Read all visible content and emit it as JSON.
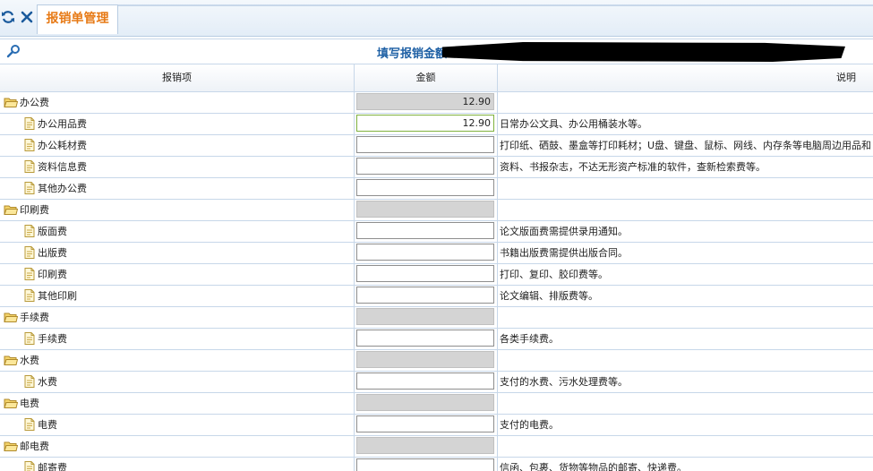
{
  "tab": {
    "title": "报销单管理"
  },
  "title_bar": {
    "title": "填写报销金额"
  },
  "grid": {
    "headers": {
      "item": "报销项",
      "amount": "金额",
      "description": "说明"
    },
    "rows": [
      {
        "name": "办公费",
        "amount": "12.90",
        "description": ""
      },
      {
        "name": "办公用品费",
        "amount": "12.90",
        "description": "日常办公文具、办公用桶装水等。"
      },
      {
        "name": "办公耗材费",
        "amount": "",
        "description": "打印纸、硒鼓、墨盒等打印耗材；U盘、键盘、鼠标、网线、内存条等电脑周边用品和"
      },
      {
        "name": "资料信息费",
        "amount": "",
        "description": "资料、书报杂志，不达无形资产标准的软件，查新检索费等。"
      },
      {
        "name": "其他办公费",
        "amount": "",
        "description": ""
      },
      {
        "name": "印刷费",
        "amount": "",
        "description": ""
      },
      {
        "name": "版面费",
        "amount": "",
        "description": "论文版面费需提供录用通知。"
      },
      {
        "name": "出版费",
        "amount": "",
        "description": "书籍出版费需提供出版合同。"
      },
      {
        "name": "印刷费",
        "amount": "",
        "description": "打印、复印、胶印费等。"
      },
      {
        "name": "其他印刷",
        "amount": "",
        "description": "论文编辑、排版费等。"
      },
      {
        "name": "手续费",
        "amount": "",
        "description": ""
      },
      {
        "name": "手续费",
        "amount": "",
        "description": "各类手续费。"
      },
      {
        "name": "水费",
        "amount": "",
        "description": ""
      },
      {
        "name": "水费",
        "amount": "",
        "description": "支付的水费、污水处理费等。"
      },
      {
        "name": "电费",
        "amount": "",
        "description": ""
      },
      {
        "name": "电费",
        "amount": "",
        "description": "支付的电费。"
      },
      {
        "name": "邮电费",
        "amount": "",
        "description": ""
      },
      {
        "name": "邮寄费",
        "amount": "",
        "description": "信函、包裹、货物等物品的邮寄、快递费。"
      }
    ]
  },
  "colors": {
    "accent_tab": "#e77a16",
    "title_blue": "#1d5fa4",
    "grid_line": "#c7d7e9",
    "readonly_fill": "#d4d4d4",
    "folder": "#f3d36a"
  }
}
